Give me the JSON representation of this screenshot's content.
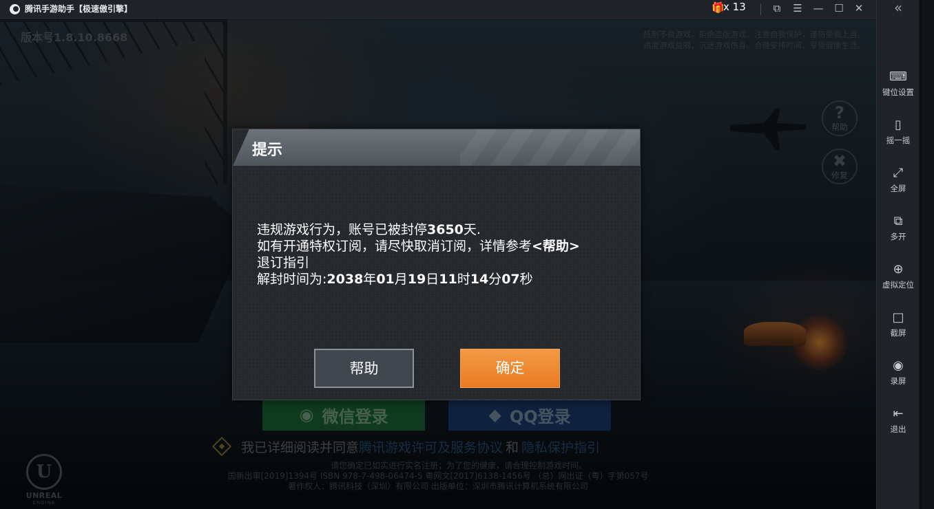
{
  "titlebar": {
    "title": "腾讯手游助手【极速傲引擎】",
    "gift_icon": "gift-icon",
    "gift_count": "x 13",
    "controls": [
      "restore-icon",
      "menu-icon",
      "minimize-icon",
      "maximize-icon",
      "close-icon"
    ]
  },
  "game": {
    "version": "版本号1.8.10.8668",
    "notice_line1": "抵制不良游戏，拒绝盗版游戏。注意自我保护，谨防受骗上当。",
    "notice_line2": "适度游戏益脑，沉迷游戏伤身。合理安排时间，享受健康生活。",
    "help_label": "帮助",
    "repair_label": "修复",
    "wechat_login": "微信登录",
    "qq_login": "QQ登录",
    "agree_text": "我已详细阅读并同意",
    "agree_link1": "腾讯游戏许可及服务协议",
    "agree_and": "和",
    "agree_link2": "隐私保护指引",
    "footer_line1": "请您确定已如实进行实名注册；为了您的健康，请合理控制游戏时间。",
    "footer_line2": "国新出审[2019]1394号  ISBN 978-7-498-06474-5  粤网文[2017]6138-1456号 （总）网出证（粤）字第057号",
    "footer_line3": "著作权人：腾讯科技（深圳）有限公司   出版单位：深圳市腾讯计算机系统有限公司",
    "engine_logo": "UNREAL",
    "engine_sub": "ENGINE"
  },
  "dialog": {
    "title": "提示",
    "line1_prefix": "违规游戏行为，账号已被封停",
    "line1_days": "3650",
    "line1_suffix": "天.",
    "line2_prefix": "如有开通特权订阅，请尽快取消订阅，详情参考",
    "line2_link": "<帮助>",
    "line3": "退订指引",
    "line4_prefix": "解封时间为:",
    "unban_year": "2038",
    "unban_year_unit": "年",
    "unban_month": "01",
    "unban_month_unit": "月",
    "unban_day": "19",
    "unban_day_unit": "日",
    "unban_hour": "11",
    "unban_hour_unit": "时",
    "unban_min": "14",
    "unban_min_unit": "分",
    "unban_sec": "07",
    "unban_sec_unit": "秒",
    "help_button": "帮助",
    "ok_button": "确定"
  },
  "sidebar": {
    "collapse_icon": "double-chevron-left-icon",
    "items": [
      {
        "label": "键位设置",
        "icon": "keyboard-icon"
      },
      {
        "label": "摇一摇",
        "icon": "shake-phone-icon"
      },
      {
        "label": "全屏",
        "icon": "fullscreen-icon"
      },
      {
        "label": "多开",
        "icon": "multi-window-icon"
      },
      {
        "label": "虚拟定位",
        "icon": "location-target-icon"
      },
      {
        "label": "截屏",
        "icon": "screenshot-icon"
      },
      {
        "label": "录屏",
        "icon": "record-icon"
      },
      {
        "label": "退出",
        "icon": "exit-icon"
      }
    ]
  },
  "colors": {
    "accent_orange": "#ea7a22",
    "titlebar_bg": "#1f2329",
    "sidebar_bg": "#202429"
  }
}
